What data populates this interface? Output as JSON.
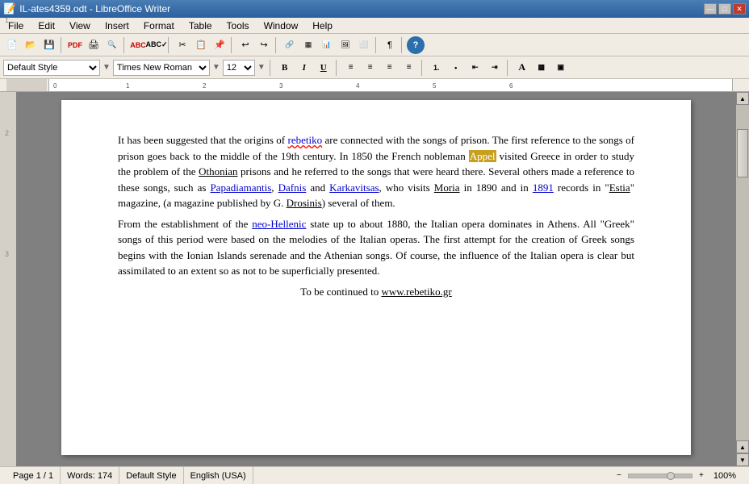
{
  "titlebar": {
    "title": "IL-ates4359.odt - LibreOffice Writer",
    "icon": "writer-icon",
    "min_label": "—",
    "max_label": "□",
    "close_label": "✕"
  },
  "menu": {
    "items": [
      "File",
      "Edit",
      "View",
      "Insert",
      "Format",
      "Table",
      "Tools",
      "Window",
      "Help"
    ]
  },
  "formatting": {
    "style": "Default Style",
    "font": "Times New Roman",
    "size": "12",
    "bold": "B",
    "italic": "I",
    "underline": "U"
  },
  "document": {
    "paragraph1": "It has been suggested that the origins of rebetiko are connected with the songs of prison. The first reference to the songs of prison goes back to the middle of the 19th century. In 1850 the French nobleman Appel visited Greece in order to study the problem of the Othonian prisons and he referred to the songs that were heard there. Several others made a reference to these songs, such as Papadiamantis, Dafnis and Karkavitsas, who visits Moria in 1890 and in 1891 records in \"Estia\" magazine, (a magazine published by G. Drosinis) several of them.",
    "paragraph2": "From the establishment of the neo-Hellenic state up to about 1880, the Italian opera dominates in Athens. All \"Greek\" songs of this period were based on the melodies of the Italian operas. The first attempt for the creation of Greek songs begins with the Ionian Islands serenade and the Athenian songs. Of course, the influence of the Italian opera is clear but assimilated to an extent so as not to be superficially presented.",
    "continued": "To be continued to www.rebetiko.gr"
  },
  "statusbar": {
    "page": "Page 1 / 1",
    "words": "Words: 174",
    "style": "Default Style",
    "language": "English (USA)",
    "zoom": "100%"
  }
}
